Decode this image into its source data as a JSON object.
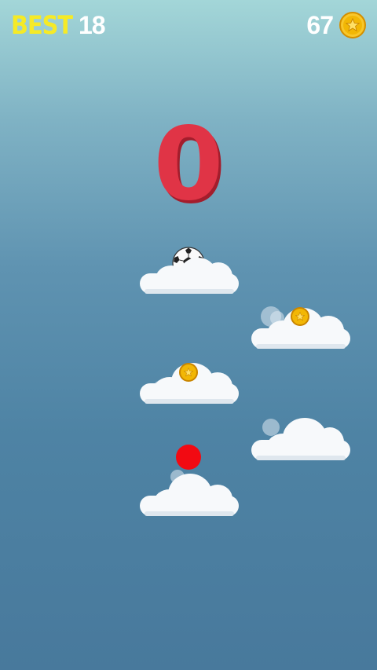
{
  "hud": {
    "best_label": "BEST",
    "best_value": "18",
    "coin_count": "67",
    "coin_icon": "star-coin-icon"
  },
  "score": "0",
  "colors": {
    "best_label": "#f5ea27",
    "score": "#e03446",
    "coin": "#f2b705",
    "red_ball": "#f20a12"
  },
  "objects": {
    "ball_icon": "soccer-ball-icon",
    "player_icon": "red-ball-icon",
    "cloud_count_visible": 5,
    "coins_on_clouds": 2
  }
}
